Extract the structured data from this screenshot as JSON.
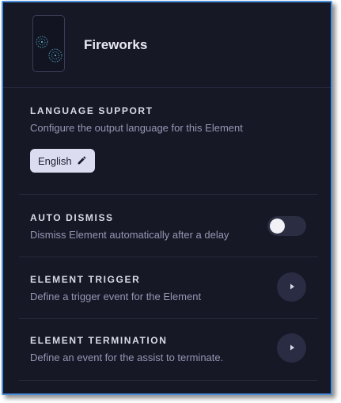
{
  "header": {
    "title": "Fireworks",
    "thumbnail_icon": "fireworks-thumbnail-icon"
  },
  "language_support": {
    "title": "LANGUAGE SUPPORT",
    "description": "Configure the output language for this Element",
    "button_label": "English",
    "button_icon": "pencil-icon"
  },
  "auto_dismiss": {
    "title": "AUTO DISMISS",
    "description": "Dismiss Element automatically after a delay",
    "enabled": false
  },
  "element_trigger": {
    "title": "ELEMENT TRIGGER",
    "description": "Define a trigger event for the Element",
    "button_icon": "play-icon"
  },
  "element_termination": {
    "title": "ELEMENT TERMINATION",
    "description": "Define an event for the assist to terminate.",
    "button_icon": "play-icon"
  },
  "colors": {
    "panel_bg": "#171826",
    "border_accent": "#4a8fe0",
    "button_bg": "#dcdcf1"
  }
}
